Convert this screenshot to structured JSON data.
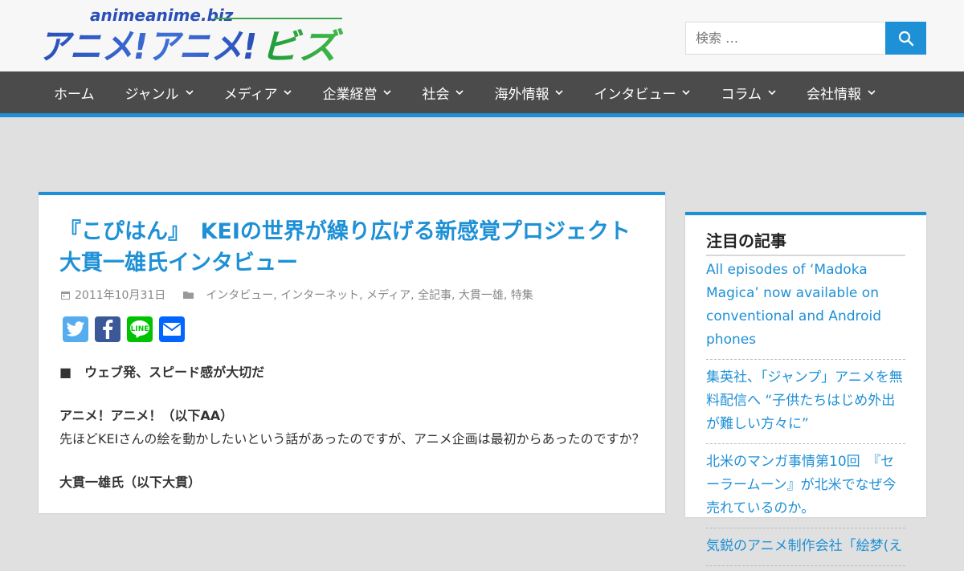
{
  "header": {
    "logo_text_top": "animeanime.biz",
    "logo_text_main": "アニメ!アニメ!",
    "logo_text_sub": "ビズ",
    "search_placeholder": "検索 …"
  },
  "nav": {
    "items": [
      {
        "label": "ホーム",
        "has_dropdown": false
      },
      {
        "label": "ジャンル",
        "has_dropdown": true
      },
      {
        "label": "メディア",
        "has_dropdown": true
      },
      {
        "label": "企業経営",
        "has_dropdown": true
      },
      {
        "label": "社会",
        "has_dropdown": true
      },
      {
        "label": "海外情報",
        "has_dropdown": true
      },
      {
        "label": "インタビュー",
        "has_dropdown": true
      },
      {
        "label": "コラム",
        "has_dropdown": true
      },
      {
        "label": "会社情報",
        "has_dropdown": true
      }
    ]
  },
  "article": {
    "title": "『こぴはん』　KEIの世界が繰り広げる新感覚プロジェクト　大貫一雄氏インタビュー",
    "date": "2011年10月31日",
    "categories": "インタビュー, インターネット, メディア, 全記事, 大貫一雄, 特集",
    "share": [
      {
        "name": "twitter",
        "color": "#55acee"
      },
      {
        "name": "facebook",
        "color": "#3b5998"
      },
      {
        "name": "line",
        "color": "#00c300"
      },
      {
        "name": "email",
        "color": "#0166ff"
      }
    ],
    "section_heading": "■　ウェブ発、スピード感が大切だ",
    "speaker1": "アニメ！アニメ！（以下AA）",
    "question": "先ほどKEIさんの絵を動かしたいという話があったのですが、アニメ企画は最初からあったのですか？",
    "speaker2": "大貫一雄氏（以下大貫）"
  },
  "sidebar": {
    "title": "注目の記事",
    "items": [
      "All episodes of ‘Madoka Magica’ now available on conventional and Android phones",
      "集英社、「ジャンプ」アニメを無料配信へ “子供たちはじめ外出が難しい方々に”",
      "北米のマンガ事情第10回　『セーラームーン』が北米でなぜ今売れているのか。",
      "気鋭のアニメ制作会社「絵梦(え"
    ]
  },
  "colors": {
    "accent": "#1e90d6",
    "nav_bg": "#4b4b4b"
  }
}
